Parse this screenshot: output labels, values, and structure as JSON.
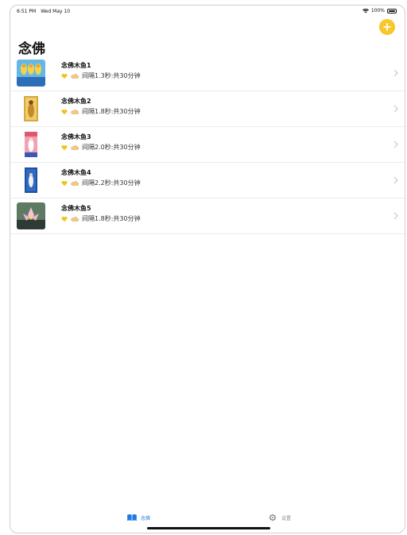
{
  "status_bar": {
    "time": "6:51 PM",
    "date": "Wed May 10",
    "battery": "100%"
  },
  "header": {
    "title": "念佛",
    "add_icon": "plus-icon",
    "accent_color": "#f7c72b"
  },
  "list": {
    "items": [
      {
        "title": "念佛木鱼1",
        "detail": "间隔1.3秒:共30分钟"
      },
      {
        "title": "念佛木鱼2",
        "detail": "间隔1.8秒:共30分钟"
      },
      {
        "title": "念佛木鱼3",
        "detail": "间隔2.0秒:共30分钟"
      },
      {
        "title": "念佛木鱼4",
        "detail": "间隔2.2秒:共30分钟"
      },
      {
        "title": "念佛木鱼5",
        "detail": "间隔1.8秒:共30分钟"
      }
    ],
    "icons": [
      "heart-icon",
      "cloud-icon",
      "chevron-right-icon"
    ]
  },
  "tabbar": {
    "tabs": [
      {
        "label": "念佛",
        "icon": "book-icon",
        "color": "#1d7be5"
      },
      {
        "label": "设置",
        "icon": "gear-icon",
        "color": "#8d8d8d"
      }
    ]
  }
}
